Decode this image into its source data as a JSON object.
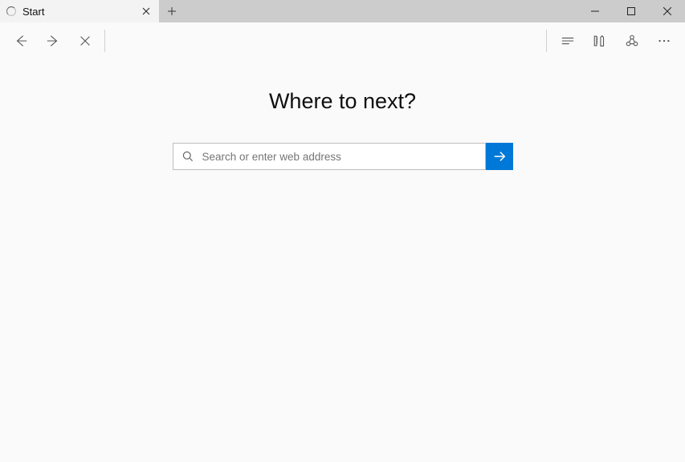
{
  "tab": {
    "title": "Start"
  },
  "hero": {
    "heading": "Where to next?"
  },
  "search": {
    "placeholder": "Search or enter web address",
    "value": ""
  },
  "colors": {
    "accent": "#0078d7"
  }
}
